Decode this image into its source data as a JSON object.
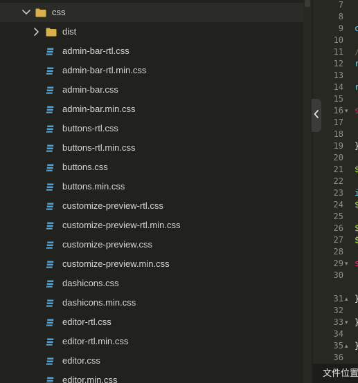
{
  "tree": {
    "root_folder": {
      "label": "css",
      "expanded": true,
      "icon": "folder-icon"
    },
    "subfolder": {
      "label": "dist",
      "expanded": false,
      "icon": "folder-icon"
    },
    "files": [
      {
        "label": "admin-bar-rtl.css"
      },
      {
        "label": "admin-bar-rtl.min.css"
      },
      {
        "label": "admin-bar.css"
      },
      {
        "label": "admin-bar.min.css"
      },
      {
        "label": "buttons-rtl.css"
      },
      {
        "label": "buttons-rtl.min.css"
      },
      {
        "label": "buttons.css"
      },
      {
        "label": "buttons.min.css"
      },
      {
        "label": "customize-preview-rtl.css"
      },
      {
        "label": "customize-preview-rtl.min.css"
      },
      {
        "label": "customize-preview.css"
      },
      {
        "label": "customize-preview.min.css"
      },
      {
        "label": "dashicons.css"
      },
      {
        "label": "dashicons.min.css"
      },
      {
        "label": "editor-rtl.css"
      },
      {
        "label": "editor-rtl.min.css"
      },
      {
        "label": "editor.css"
      },
      {
        "label": "editor.min.css"
      }
    ]
  },
  "gutter": {
    "line_numbers": [
      "7",
      "8",
      "9",
      "10",
      "11",
      "12",
      "13",
      "14",
      "15",
      "16",
      "17",
      "18",
      "19",
      "20",
      "21",
      "22",
      "23",
      "24",
      "25",
      "26",
      "27",
      "28",
      "29",
      "30",
      "",
      "31",
      "32",
      "33",
      "34",
      "35",
      "36"
    ],
    "fold_markers": {
      "16": "▾",
      "29": "▾",
      "31": "▴",
      "33": "▾",
      "35": "▴"
    },
    "glyphs": {
      "9": {
        "text": "c",
        "color": "#66d9ef"
      },
      "11": {
        "text": "/",
        "color": "#75715e"
      },
      "12": {
        "text": "r",
        "color": "#66d9ef"
      },
      "14": {
        "text": "r",
        "color": "#66d9ef"
      },
      "16": {
        "text": "s",
        "color": "#f92672"
      },
      "19": {
        "text": "}",
        "color": "#f8f8f2"
      },
      "21": {
        "text": "$",
        "color": "#a6e22e"
      },
      "23": {
        "text": "i",
        "color": "#66d9ef"
      },
      "24": {
        "text": "$",
        "color": "#a6e22e"
      },
      "26": {
        "text": "$",
        "color": "#a6e22e"
      },
      "27": {
        "text": "$",
        "color": "#a6e22e"
      },
      "29": {
        "text": "s",
        "color": "#f92672"
      },
      "31": {
        "text": "}",
        "color": "#f8f8f2"
      },
      "33": {
        "text": "}",
        "color": "#f8f8f2"
      },
      "35": {
        "text": "}",
        "color": "#f8f8f2"
      }
    }
  },
  "bottom_panel": {
    "label": "文件位置"
  },
  "colors": {
    "folder": "#d9b04a",
    "css_icon": "#4aa3df",
    "chevron": "#c8c8c4"
  }
}
